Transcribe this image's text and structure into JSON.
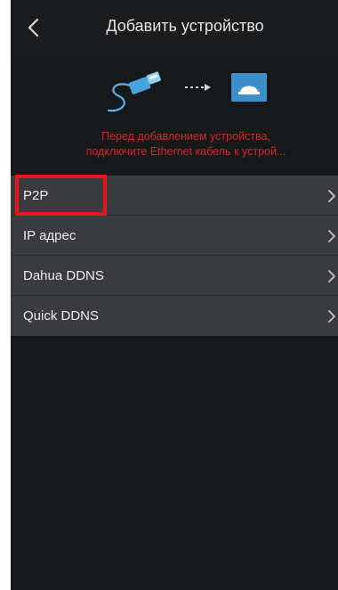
{
  "header": {
    "title": "Добавить устройство",
    "back_icon": "chevron-left-icon"
  },
  "illustration": {
    "icons": [
      "ethernet-cable-icon",
      "dashed-arrow-icon",
      "device-icon"
    ],
    "accent": "#4aa3df"
  },
  "notice": {
    "line1": "Перед добавлением устройства,",
    "line2": "подключите Ethernet кабель к устрой...",
    "color": "#d62828"
  },
  "menu": {
    "items": [
      {
        "label": "P2P",
        "highlighted": true
      },
      {
        "label": "IP адрес"
      },
      {
        "label": "Dahua DDNS"
      },
      {
        "label": "Quick DDNS"
      }
    ],
    "chevron_icon": "chevron-right-icon"
  },
  "colors": {
    "background": "#17181a",
    "menu_row": "#3a3b3e",
    "highlight": "#e5161c"
  }
}
